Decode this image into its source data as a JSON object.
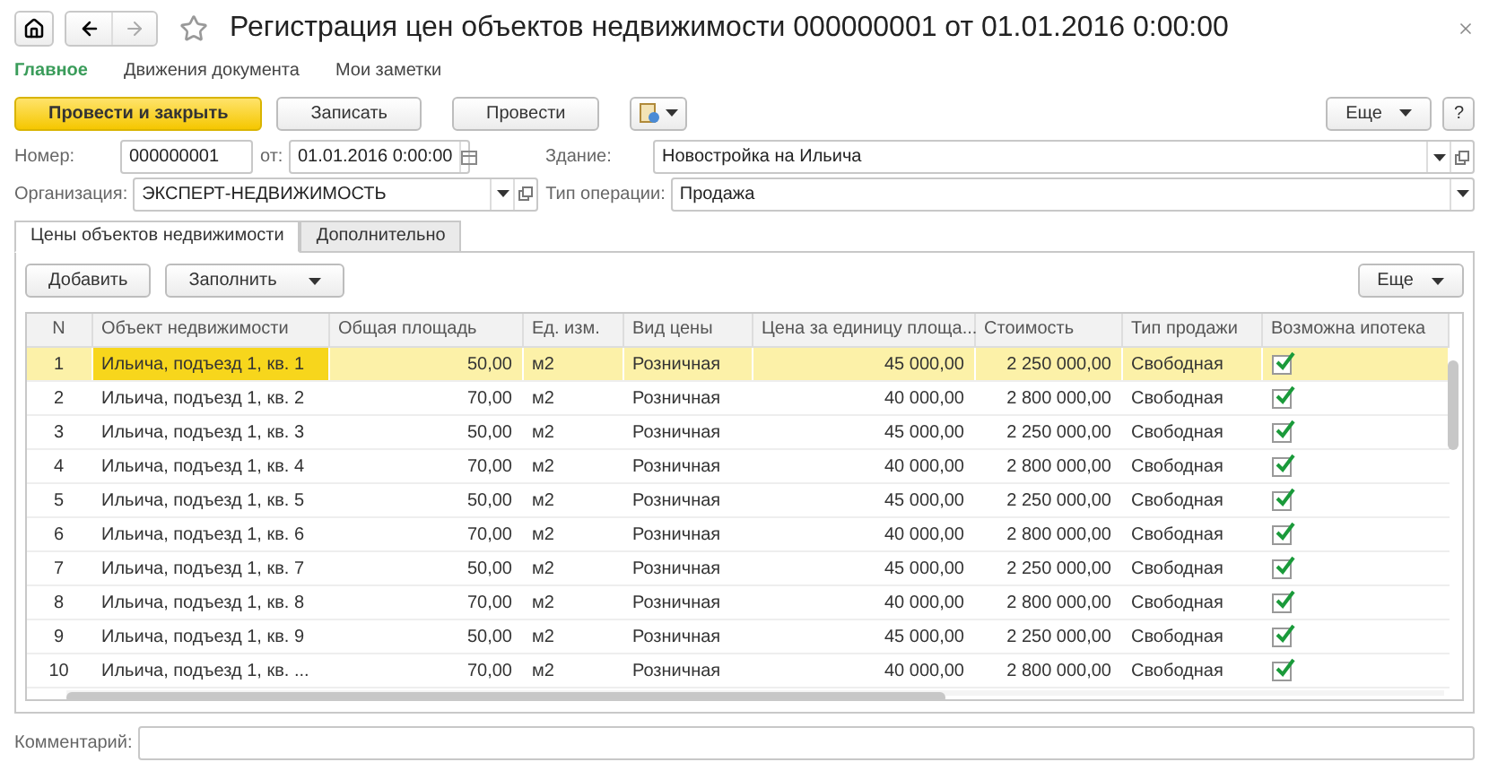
{
  "window": {
    "title": "Регистрация цен объектов недвижимости 000000001 от 01.01.2016 0:00:00"
  },
  "sections": [
    {
      "label": "Главное",
      "selected": true
    },
    {
      "label": "Движения документа",
      "selected": false
    },
    {
      "label": "Мои заметки",
      "selected": false
    }
  ],
  "toolbar": {
    "primary": "Провести и закрыть",
    "buttons": [
      "Записать",
      "Провести"
    ],
    "more": "Еще",
    "help": "?"
  },
  "fields": {
    "number": {
      "label": "Номер:",
      "value": "000000001"
    },
    "date": {
      "label": "от:",
      "value": "01.01.2016  0:00:00"
    },
    "building": {
      "label": "Здание:",
      "value": "Новостройка на Ильича"
    },
    "organization": {
      "label": "Организация:",
      "value": "ЭКСПЕРТ-НЕДВИЖИМОСТЬ"
    },
    "operation": {
      "label": "Тип операции:",
      "value": "Продажа"
    }
  },
  "tabs": [
    {
      "label": "Цены объектов недвижимости",
      "selected": true
    },
    {
      "label": "Дополнительно",
      "selected": false
    }
  ],
  "table_toolbar": {
    "add": "Добавить",
    "fill": "Заполнить",
    "more": "Еще"
  },
  "table": {
    "columns": [
      "N",
      "Объект недвижимости",
      "Общая площадь",
      "Ед. изм.",
      "Вид цены",
      "Цена за единицу площа...",
      "Стоимость",
      "Тип продажи",
      "Возможна ипотека"
    ],
    "rows": [
      {
        "n": "1",
        "object": "Ильича, подъезд 1, кв. 1",
        "area": "50,00",
        "unit": "м2",
        "price_kind": "Розничная",
        "unit_price": "45 000,00",
        "cost": "2 250 000,00",
        "sale_type": "Свободная",
        "mortgage": true,
        "selected": true
      },
      {
        "n": "2",
        "object": "Ильича, подъезд 1, кв. 2",
        "area": "70,00",
        "unit": "м2",
        "price_kind": "Розничная",
        "unit_price": "40 000,00",
        "cost": "2 800 000,00",
        "sale_type": "Свободная",
        "mortgage": true,
        "selected": false
      },
      {
        "n": "3",
        "object": "Ильича, подъезд 1, кв. 3",
        "area": "50,00",
        "unit": "м2",
        "price_kind": "Розничная",
        "unit_price": "45 000,00",
        "cost": "2 250 000,00",
        "sale_type": "Свободная",
        "mortgage": true,
        "selected": false
      },
      {
        "n": "4",
        "object": "Ильича, подъезд 1, кв. 4",
        "area": "70,00",
        "unit": "м2",
        "price_kind": "Розничная",
        "unit_price": "40 000,00",
        "cost": "2 800 000,00",
        "sale_type": "Свободная",
        "mortgage": true,
        "selected": false
      },
      {
        "n": "5",
        "object": "Ильича, подъезд 1, кв. 5",
        "area": "50,00",
        "unit": "м2",
        "price_kind": "Розничная",
        "unit_price": "45 000,00",
        "cost": "2 250 000,00",
        "sale_type": "Свободная",
        "mortgage": true,
        "selected": false
      },
      {
        "n": "6",
        "object": "Ильича, подъезд 1, кв. 6",
        "area": "70,00",
        "unit": "м2",
        "price_kind": "Розничная",
        "unit_price": "40 000,00",
        "cost": "2 800 000,00",
        "sale_type": "Свободная",
        "mortgage": true,
        "selected": false
      },
      {
        "n": "7",
        "object": "Ильича, подъезд 1, кв. 7",
        "area": "50,00",
        "unit": "м2",
        "price_kind": "Розничная",
        "unit_price": "45 000,00",
        "cost": "2 250 000,00",
        "sale_type": "Свободная",
        "mortgage": true,
        "selected": false
      },
      {
        "n": "8",
        "object": "Ильича, подъезд 1, кв. 8",
        "area": "70,00",
        "unit": "м2",
        "price_kind": "Розничная",
        "unit_price": "40 000,00",
        "cost": "2 800 000,00",
        "sale_type": "Свободная",
        "mortgage": true,
        "selected": false
      },
      {
        "n": "9",
        "object": "Ильича, подъезд 1, кв. 9",
        "area": "50,00",
        "unit": "м2",
        "price_kind": "Розничная",
        "unit_price": "45 000,00",
        "cost": "2 250 000,00",
        "sale_type": "Свободная",
        "mortgage": true,
        "selected": false
      },
      {
        "n": "10",
        "object": "Ильича, подъезд 1, кв. ...",
        "area": "70,00",
        "unit": "м2",
        "price_kind": "Розничная",
        "unit_price": "40 000,00",
        "cost": "2 800 000,00",
        "sale_type": "Свободная",
        "mortgage": true,
        "selected": false
      }
    ]
  },
  "comment": {
    "label": "Комментарий:"
  }
}
